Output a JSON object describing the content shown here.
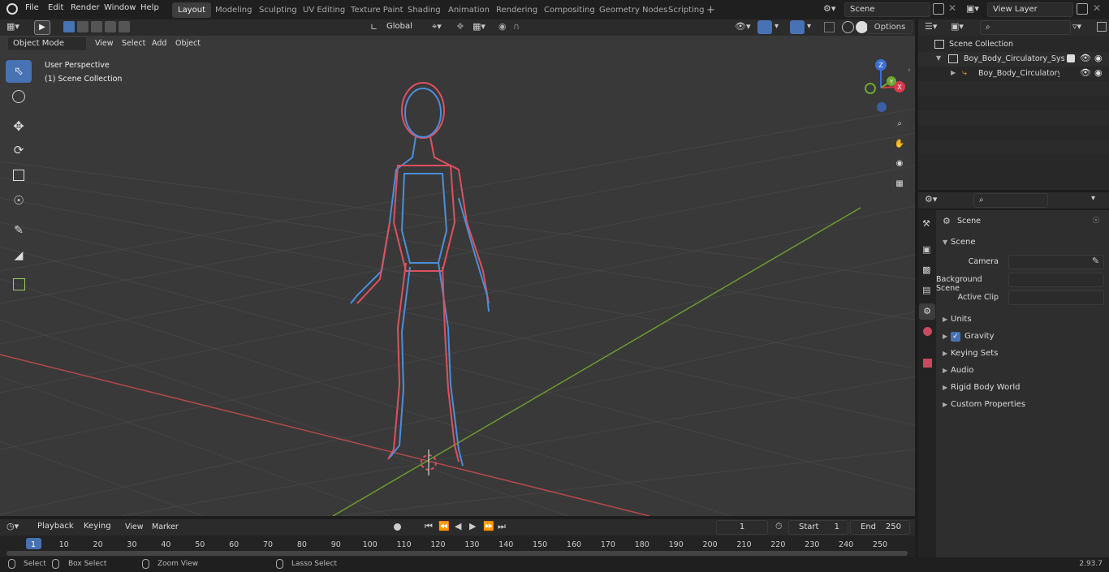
{
  "topbar": {
    "menus": [
      "File",
      "Edit",
      "Render",
      "Window",
      "Help"
    ],
    "workspaces": [
      "Layout",
      "Modeling",
      "Sculpting",
      "UV Editing",
      "Texture Paint",
      "Shading",
      "Animation",
      "Rendering",
      "Compositing",
      "Geometry Nodes",
      "Scripting"
    ],
    "active_workspace": "Layout",
    "add_tab": "+",
    "scene_name": "Scene",
    "view_layer": "View Layer"
  },
  "viewport_header": {
    "mode": "Object Mode",
    "menus": [
      "View",
      "Select",
      "Add",
      "Object"
    ],
    "transform_orientation": "Global",
    "options": "Options"
  },
  "viewport": {
    "perspective_label": "User Perspective",
    "collection_label": "(1) Scene Collection",
    "gizmo_axes": {
      "x": "X",
      "y": "Y",
      "z": "Z"
    },
    "tools": [
      "select-box-tool",
      "cursor-tool",
      "move-tool",
      "rotate-tool",
      "scale-tool",
      "transform-tool",
      "annotate-tool",
      "measure-tool",
      "add-cube-tool"
    ],
    "axis_colors": {
      "x": "#b3484c",
      "y": "#6e9a2f"
    },
    "wire_colors": {
      "veins": "#4c8ed9",
      "arteries": "#e05060"
    }
  },
  "outliner": {
    "root": "Scene Collection",
    "items": [
      {
        "name": "Boy_Body_Circulatory_System",
        "level": 1,
        "checked": true
      },
      {
        "name": "Boy_Body_Circulatory_System",
        "level": 2,
        "checked": false
      }
    ]
  },
  "properties": {
    "breadcrumb": "Scene",
    "section": "Scene",
    "fields": [
      {
        "label": "Camera",
        "value": ""
      },
      {
        "label": "Background Scene",
        "value": ""
      },
      {
        "label": "Active Clip",
        "value": ""
      }
    ],
    "panels": [
      {
        "label": "Units",
        "checkbox": false
      },
      {
        "label": "Gravity",
        "checkbox": true
      },
      {
        "label": "Keying Sets",
        "checkbox": false
      },
      {
        "label": "Audio",
        "checkbox": false
      },
      {
        "label": "Rigid Body World",
        "checkbox": false
      },
      {
        "label": "Custom Properties",
        "checkbox": false
      }
    ]
  },
  "timeline": {
    "menus": [
      "Playback",
      "Keying",
      "View",
      "Marker"
    ],
    "current_frame": "1",
    "start_label": "Start",
    "start": "1",
    "end_label": "End",
    "end": "250",
    "ticks": [
      "1",
      "10",
      "20",
      "30",
      "40",
      "50",
      "60",
      "70",
      "80",
      "90",
      "100",
      "110",
      "120",
      "130",
      "140",
      "150",
      "160",
      "170",
      "180",
      "190",
      "200",
      "210",
      "220",
      "230",
      "240",
      "250"
    ]
  },
  "status": {
    "items": [
      "Select",
      "Box Select",
      "Zoom View",
      "Lasso Select"
    ],
    "version": "2.93.7"
  }
}
